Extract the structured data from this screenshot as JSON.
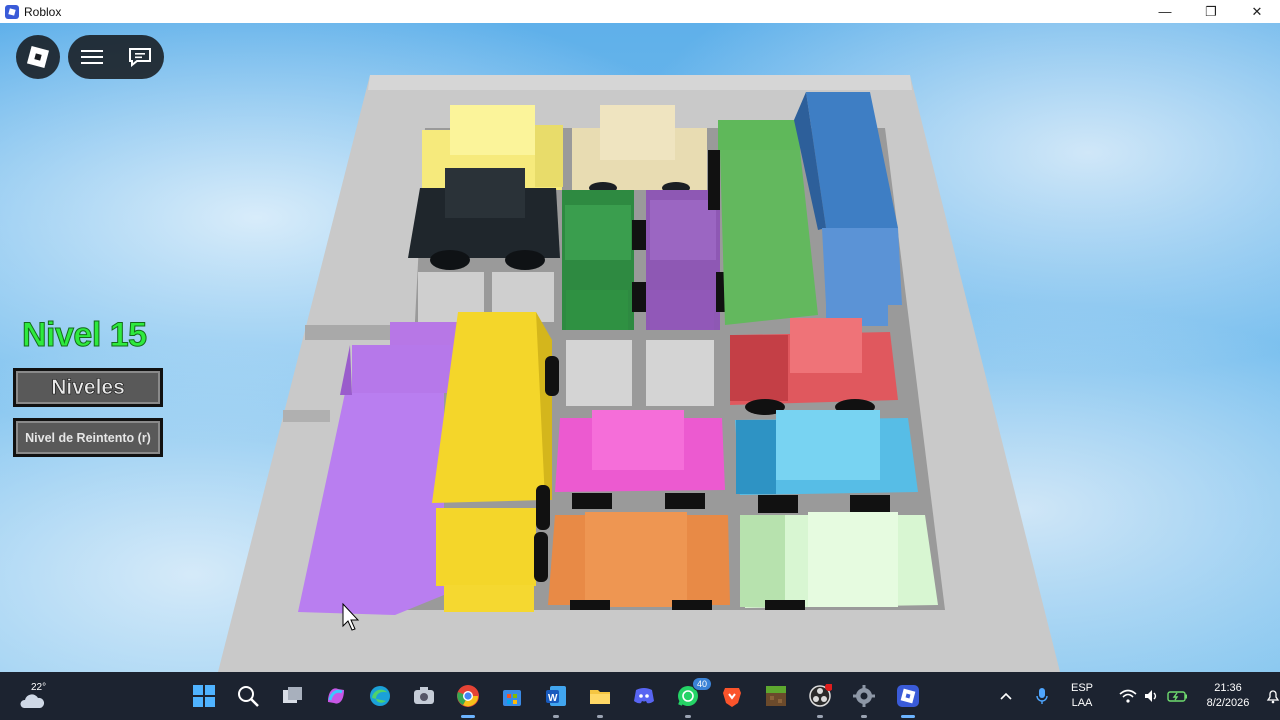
{
  "window": {
    "title": "Roblox",
    "controls": {
      "minimize": "—",
      "restore": "❐",
      "close": "✕"
    }
  },
  "game": {
    "level_label": "Nivel 15",
    "levels_button": "Niveles",
    "retry_button": "Nivel de Reintento (r)"
  },
  "taskbar": {
    "weather": {
      "temp": "22°",
      "icon": "cloud-icon"
    },
    "apps": [
      {
        "name": "start-icon"
      },
      {
        "name": "search-icon"
      },
      {
        "name": "task-view-icon"
      },
      {
        "name": "copilot-icon"
      },
      {
        "name": "edge-icon"
      },
      {
        "name": "camera-icon"
      },
      {
        "name": "chrome-icon"
      },
      {
        "name": "store-icon"
      },
      {
        "name": "word-icon"
      },
      {
        "name": "file-explorer-icon"
      },
      {
        "name": "discord-icon"
      },
      {
        "name": "whatsapp-icon",
        "badge": "40"
      },
      {
        "name": "brave-icon"
      },
      {
        "name": "minecraft-icon"
      },
      {
        "name": "obs-icon"
      },
      {
        "name": "settings-icon"
      },
      {
        "name": "roblox-icon"
      }
    ],
    "tray": {
      "language_top": "ESP",
      "language_bottom": "LAA",
      "time": "21:36",
      "date": "8/2/2026"
    }
  },
  "colors": {
    "level_text": "#2eea3e",
    "taskbar_bg": "#1c2330",
    "board": "#c8c8c8"
  }
}
